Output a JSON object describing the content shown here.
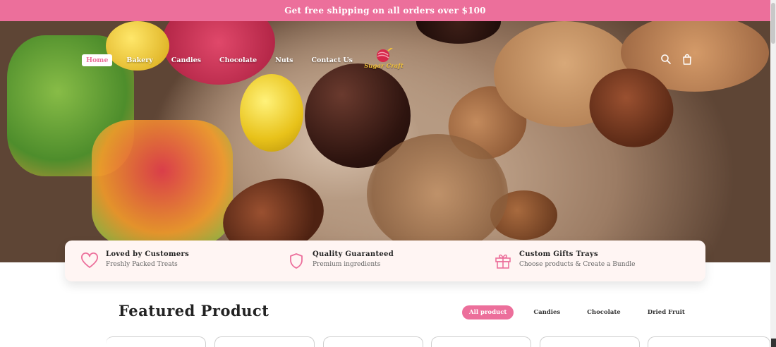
{
  "announcement": "Get free shipping on all orders over $100",
  "nav": {
    "items": [
      {
        "label": "Home",
        "active": true
      },
      {
        "label": "Bakery",
        "active": false
      },
      {
        "label": "Candies",
        "active": false
      },
      {
        "label": "Chocolate",
        "active": false
      },
      {
        "label": "Nuts",
        "active": false
      },
      {
        "label": "Contact Us",
        "active": false
      }
    ]
  },
  "logo": {
    "text": "Sugar Craft"
  },
  "header_icons": [
    "search-icon",
    "shopping-bag-icon"
  ],
  "features": [
    {
      "icon": "heart-icon",
      "title": "Loved by Customers",
      "subtitle": "Freshly Packed Treats"
    },
    {
      "icon": "shield-icon",
      "title": "Quality Guaranteed",
      "subtitle": "Premium ingredients"
    },
    {
      "icon": "gift-icon",
      "title": "Custom Gifts Trays",
      "subtitle": "Choose products & Create a Bundle"
    }
  ],
  "featured": {
    "title": "Featured Product",
    "filters": [
      {
        "label": "All product",
        "active": true
      },
      {
        "label": "Candies",
        "active": false
      },
      {
        "label": "Chocolate",
        "active": false
      },
      {
        "label": "Dried Fruit",
        "active": false
      }
    ]
  },
  "colors": {
    "accent": "#ec6f9b",
    "feature_bg": "#fff5f3",
    "logo_gold": "#f2c23a"
  }
}
